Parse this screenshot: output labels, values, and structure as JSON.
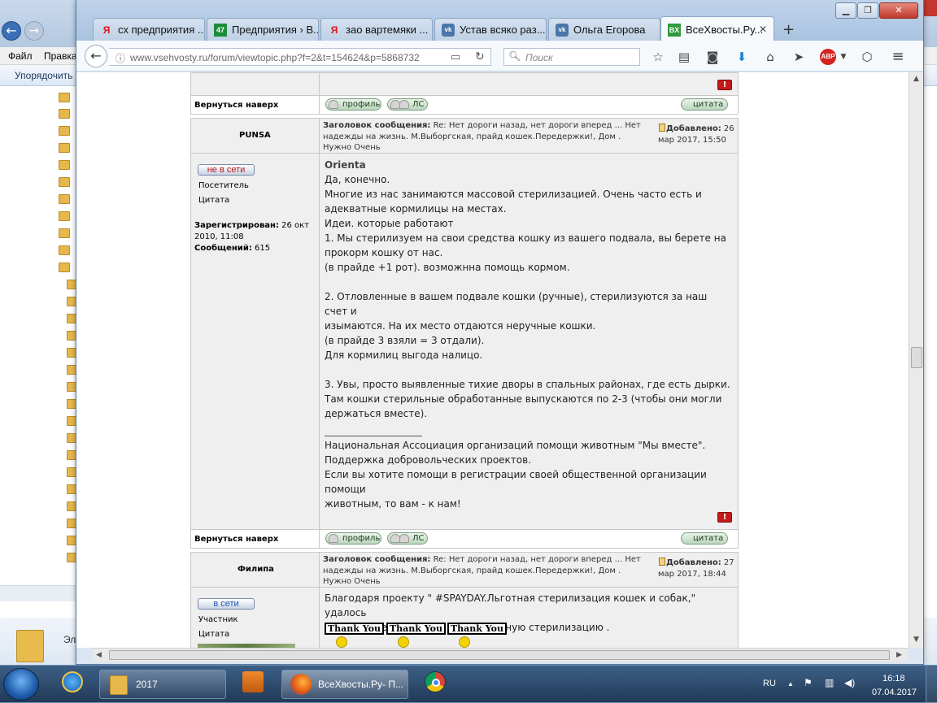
{
  "explorer": {
    "menu": [
      "Файл",
      "Правка"
    ],
    "command": "Упорядочить",
    "status_text": "Эл"
  },
  "browser": {
    "tabs": [
      {
        "icon": "Я",
        "label": "сх предприятия ..."
      },
      {
        "icon": "47",
        "label": "Предприятия › В..."
      },
      {
        "icon": "Я",
        "label": "зао вартемяки ..."
      },
      {
        "icon": "vk",
        "label": "Устав всяко раз..."
      },
      {
        "icon": "vk",
        "label": "Ольга Егорова"
      },
      {
        "icon": "BX",
        "label": "ВсеХвосты.Ру..."
      }
    ],
    "url": "www.vsehvosty.ru/forum/viewtopic.php?f=2&t=154624&p=5868732",
    "search_placeholder": "Поиск",
    "adblock": "ABP"
  },
  "forum": {
    "back_to_top": "Вернуться наверх",
    "btn_profile": "профиль",
    "btn_pm": "ЛС",
    "btn_quote": "цитата",
    "subject_label": "Заголовок сообщения:",
    "added_label": "Добавлено:",
    "posts": [
      {
        "author": "PUNSA",
        "subject": "Re: Нет дороги назад, нет дороги вперед ... Нет надежды на жизнь. М.Выборгская, прайд кошек.Передержки!, Дом . Нужно Очень",
        "date": "26 мар 2017, 15:50",
        "status": "не в сети",
        "rank": "Посетитель",
        "quote_link": "Цитата",
        "registered_label": "Зарегистрирован:",
        "registered": "26 окт 2010, 11:08",
        "posts_label": "Сообщений:",
        "posts_count": "615",
        "quoted_name": "Orienta",
        "body": "Да, конечно.\nМногие из нас занимаются массовой стерилизацией. Очень часто есть и\nадекватные кормилицы на местах.\nИдеи. которые работают\n1. Мы стерилизуем на свои средства кошку из вашего подвала, вы берете на\nпрокорм кошку от нас.\n(в прайде +1 рот). возможнна помощь кормом.\n\n2. Отловленные в вашем подвале кошки (ручные), стерилизуются за наш счет и\nизымаются. На их место отдаются неручные кошки.\n(в прайде 3 взяли = 3 отдали).\nДля кормилиц выгода налицо.\n\n3. Увы, просто выявленные тихие дворы в спальных районах, где есть дырки.\nТам кошки стерильные обработанные выпускаются по 2-3 (чтобы они могли\nдержаться вместе).",
        "signature": "Национальная Ассоциация организаций помощи животным \"Мы вместе\".\nПоддержка добровольческих проектов.\nЕсли вы хотите помощи в регистрации своей общественной организации помощи\nживотным, то вам - к нам!"
      },
      {
        "author": "Филипа",
        "subject": "Re: Нет дороги назад, нет дороги вперед ... Нет надежды на жизнь. М.Выборгская, прайд кошек.Передержки!, Дом . Нужно Очень",
        "date": "27 мар 2017, 18:44",
        "status": "в сети",
        "rank": "Участник",
        "quote_link": "Цитата",
        "body": "Благодаря проекту \" #SPAYDAY.Льготная стерилизация кошек и собак,\" удалось\nполучить сертификаты на бесплатную стерилизацию .",
        "thanks": [
          "Thank You",
          "Thank You",
          "Thank You"
        ]
      }
    ]
  },
  "taskbar": {
    "items": [
      "2017",
      "ВсеХвосты.Ру- П..."
    ],
    "lang": "RU",
    "time": "16:18",
    "date": "07.04.2017"
  }
}
